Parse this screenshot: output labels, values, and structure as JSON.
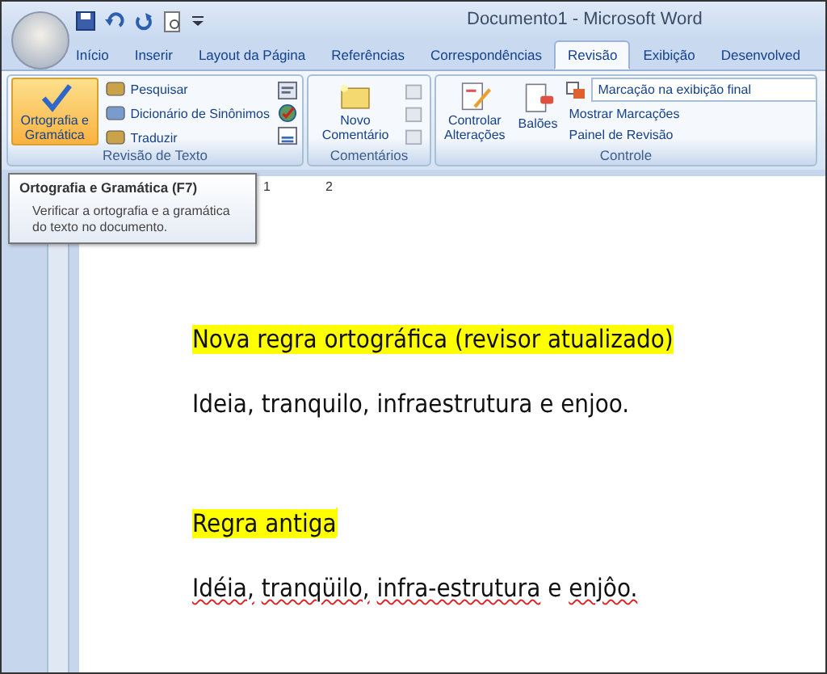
{
  "window": {
    "title": "Documento1 - Microsoft Word"
  },
  "tabs": [
    {
      "label": "Início",
      "selected": false
    },
    {
      "label": "Inserir",
      "selected": false
    },
    {
      "label": "Layout da Página",
      "selected": false
    },
    {
      "label": "Referências",
      "selected": false
    },
    {
      "label": "Correspondências",
      "selected": false
    },
    {
      "label": "Revisão",
      "selected": true
    },
    {
      "label": "Exibição",
      "selected": false
    },
    {
      "label": "Desenvolved",
      "selected": false
    }
  ],
  "proofing_group": {
    "label": "Revisão de Texto",
    "spelling_button": {
      "label": "Ortografia e Gramática",
      "selected": true
    },
    "items": [
      "Pesquisar",
      "Dicionário de Sinônimos",
      "Traduzir"
    ]
  },
  "comments_group": {
    "label": "Comentários",
    "new_comment": "Novo Comentário"
  },
  "tracking_group": {
    "label": "Controle",
    "track_changes": "Controlar Alterações",
    "balloons": "Balões",
    "display_dropdown": "Marcação na exibição final",
    "show_markup": "Mostrar Marcações",
    "reviewing_pane": "Painel de Revisão"
  },
  "tooltip": {
    "title": "Ortografia e Gramática (F7)",
    "body": "Verificar a ortografia e a gramática do texto no documento."
  },
  "ruler": {
    "numbers": [
      "1",
      "2"
    ]
  },
  "document": {
    "paragraphs": [
      {
        "highlighted": true,
        "cursor": false,
        "words": [
          {
            "text": "Nova regra ortográfica (revisor atualizado)",
            "error": false
          }
        ]
      },
      {
        "highlighted": false,
        "cursor": false,
        "words": [
          {
            "text": "Ideia,",
            "error": false
          },
          {
            "text": "tranquilo,",
            "error": false
          },
          {
            "text": "infraestrutura",
            "error": false
          },
          {
            "text": "e",
            "error": false
          },
          {
            "text": "enjoo.",
            "error": false
          }
        ]
      },
      {
        "highlighted": true,
        "cursor": true,
        "words": [
          {
            "text": "Regra antiga",
            "error": false
          }
        ]
      },
      {
        "highlighted": false,
        "cursor": false,
        "words": [
          {
            "text": "Idéia,",
            "error": true
          },
          {
            "text": "tranqüilo,",
            "error": true
          },
          {
            "text": "infra-estrutura",
            "error": true
          },
          {
            "text": "e",
            "error": false
          },
          {
            "text": "enjôo.",
            "error": true
          }
        ]
      }
    ]
  }
}
